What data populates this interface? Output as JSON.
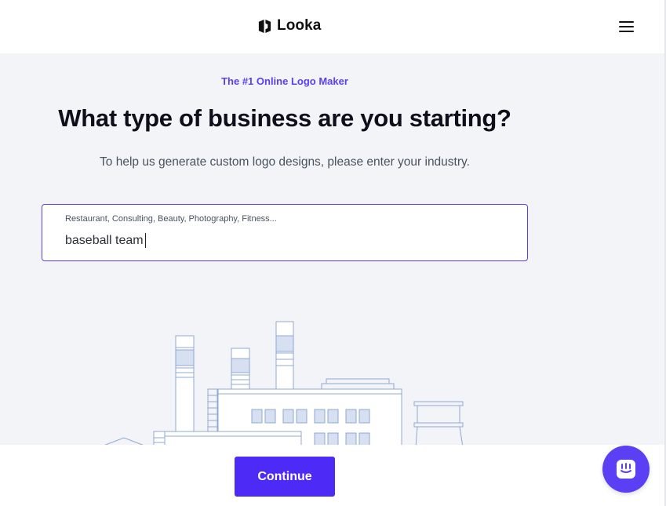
{
  "header": {
    "brand": "Looka",
    "logo_icon": "looka-logo-icon",
    "menu_icon": "hamburger-menu-icon"
  },
  "main": {
    "tagline": "The #1 Online Logo Maker",
    "title": "What type of business are you starting?",
    "subtitle": "To help us generate custom logo designs, please enter your industry."
  },
  "industry_field": {
    "label": "Restaurant, Consulting, Beauty, Photography, Fitness...",
    "value": "baseball team"
  },
  "footer": {
    "continue_label": "Continue"
  },
  "chat": {
    "icon": "chat-icon"
  },
  "colors": {
    "accent": "#5a3ff4",
    "button": "#4d2af5",
    "background": "#f3f4f7",
    "illustration_stroke": "#8fa8d6",
    "illustration_fill": "#d6e0f0"
  }
}
